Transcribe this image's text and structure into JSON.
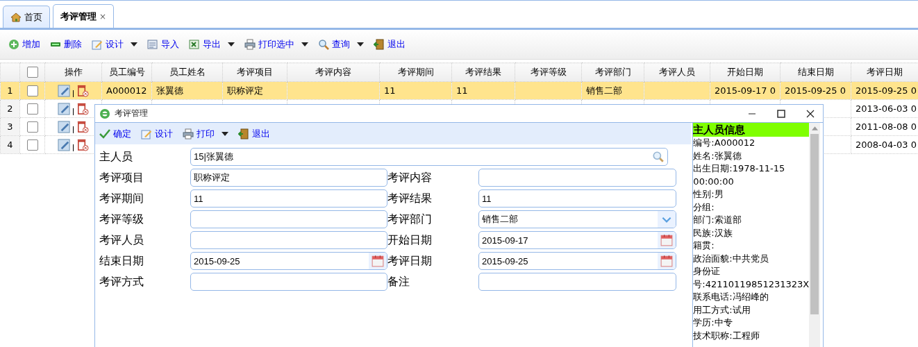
{
  "tabs": [
    {
      "label": "首页",
      "selected": false,
      "closable": false
    },
    {
      "label": "考评管理",
      "selected": true,
      "closable": true,
      "close": "×"
    }
  ],
  "toolbar": [
    {
      "label": "增加",
      "kind": "add",
      "dropdown": false
    },
    {
      "label": "删除",
      "kind": "remove",
      "dropdown": false
    },
    {
      "label": "设计",
      "kind": "design",
      "dropdown": true
    },
    {
      "label": "导入",
      "kind": "import",
      "dropdown": false
    },
    {
      "label": "导出",
      "kind": "export",
      "dropdown": true
    },
    {
      "label": "打印选中",
      "kind": "print",
      "dropdown": true
    },
    {
      "label": "查询",
      "kind": "search",
      "dropdown": true
    },
    {
      "label": "退出",
      "kind": "exit",
      "dropdown": false
    }
  ],
  "table": {
    "all_checked": false,
    "columns": [
      "",
      "",
      "操作",
      "员工编号",
      "员工姓名",
      "考评项目",
      "考评内容",
      "考评期间",
      "考评结果",
      "考评等级",
      "考评部门",
      "考评人员",
      "开始日期",
      "结束日期",
      "考评日期"
    ],
    "rows": [
      {
        "selected": true,
        "checked": false,
        "cells": [
          "1",
          "",
          "",
          "A000012",
          "张翼德",
          "职称评定",
          "",
          "11",
          "11",
          "",
          "销售二部",
          "",
          "2015-09-17 0",
          "2015-09-25 0",
          "2015-09-25 0"
        ]
      },
      {
        "selected": false,
        "checked": false,
        "cells": [
          "2",
          "",
          "",
          "",
          "",
          "",
          "",
          "",
          "",
          "",
          "",
          "",
          "",
          "",
          "2013-06-03 0"
        ]
      },
      {
        "selected": false,
        "checked": false,
        "cells": [
          "3",
          "",
          "",
          "",
          "",
          "",
          "",
          "",
          "",
          "",
          "",
          "",
          "",
          "",
          "2011-08-08 0"
        ]
      },
      {
        "selected": false,
        "checked": false,
        "cells": [
          "4",
          "",
          "",
          "",
          "",
          "",
          "",
          "",
          "",
          "",
          "",
          "",
          "",
          "",
          "2008-04-03 0"
        ]
      }
    ]
  },
  "dialog": {
    "title": "考评管理",
    "toolbar": [
      {
        "label": "确定",
        "kind": "check",
        "dropdown": false
      },
      {
        "label": "设计",
        "kind": "design",
        "dropdown": false
      },
      {
        "label": "打印",
        "kind": "print",
        "dropdown": true
      },
      {
        "label": "退出",
        "kind": "exit",
        "dropdown": false
      }
    ],
    "main_person": {
      "label": "主人员",
      "value": "15|张翼德"
    },
    "fields": [
      {
        "label": "考评项目",
        "value": "职称评定",
        "kind": "text"
      },
      {
        "label": "考评内容",
        "kind": "text"
      },
      {
        "label": "考评期间",
        "value": "11",
        "kind": "text"
      },
      {
        "label": "考评结果",
        "value": "11",
        "kind": "text"
      },
      {
        "label": "考评等级",
        "kind": "text"
      },
      {
        "label": "考评部门",
        "value": "销售二部",
        "kind": "combo"
      },
      {
        "label": "考评人员",
        "kind": "text"
      },
      {
        "label": "开始日期",
        "value": "2015-09-17",
        "kind": "date"
      },
      {
        "label": "结束日期",
        "value": "2015-09-25",
        "kind": "date"
      },
      {
        "label": "考评日期",
        "value": "2015-09-25",
        "kind": "date"
      },
      {
        "label": "考评方式",
        "kind": "text"
      },
      {
        "label": "备注",
        "kind": "text"
      }
    ],
    "info_panel": {
      "title": "主人员信息",
      "lines": [
        "编号:A000012",
        "姓名:张翼德",
        "出生日期:1978-11-15 00:00:00",
        "性别:男",
        "分组:",
        "部门:索道部",
        "民族:汉族",
        "籍贯:",
        "政治面貌:中共党员",
        "身份证号:42110119851231323X",
        "联系电话:冯绍峰的",
        "用工方式:试用",
        "学历:中专",
        "技术职称:工程师"
      ]
    }
  }
}
